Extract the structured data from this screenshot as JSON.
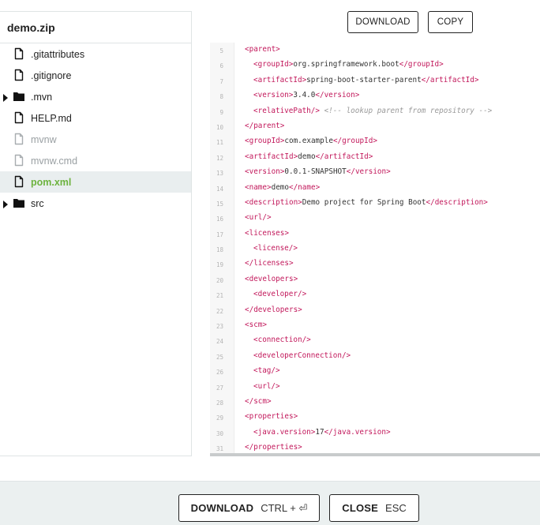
{
  "explorer": {
    "title": "demo.zip",
    "items": [
      {
        "label": ".gitattributes",
        "type": "file",
        "state": "normal"
      },
      {
        "label": ".gitignore",
        "type": "file",
        "state": "normal"
      },
      {
        "label": ".mvn",
        "type": "folder",
        "state": "collapsed"
      },
      {
        "label": "HELP.md",
        "type": "file",
        "state": "normal"
      },
      {
        "label": "mvnw",
        "type": "file",
        "state": "disabled"
      },
      {
        "label": "mvnw.cmd",
        "type": "file",
        "state": "disabled"
      },
      {
        "label": "pom.xml",
        "type": "file",
        "state": "active"
      },
      {
        "label": "src",
        "type": "folder",
        "state": "collapsed"
      }
    ]
  },
  "toolbar": {
    "download_label": "DOWNLOAD",
    "copy_label": "COPY"
  },
  "code": {
    "lines": [
      {
        "n": "5",
        "indent": 0,
        "parts": [
          [
            "tag",
            "<parent>"
          ]
        ]
      },
      {
        "n": "6",
        "indent": 1,
        "parts": [
          [
            "tag",
            "<groupId>"
          ],
          [
            "plain",
            "org.springframework.boot"
          ],
          [
            "tag",
            "</groupId>"
          ]
        ]
      },
      {
        "n": "7",
        "indent": 1,
        "parts": [
          [
            "tag",
            "<artifactId>"
          ],
          [
            "plain",
            "spring-boot-starter-parent"
          ],
          [
            "tag",
            "</artifactId>"
          ]
        ]
      },
      {
        "n": "8",
        "indent": 1,
        "parts": [
          [
            "tag",
            "<version>"
          ],
          [
            "plain",
            "3.4.0"
          ],
          [
            "tag",
            "</version>"
          ]
        ]
      },
      {
        "n": "9",
        "indent": 1,
        "parts": [
          [
            "tag",
            "<relativePath/>"
          ],
          [
            "plain",
            " "
          ],
          [
            "comment",
            "<!-- lookup parent from repository -->"
          ]
        ]
      },
      {
        "n": "10",
        "indent": 0,
        "parts": [
          [
            "tag",
            "</parent>"
          ]
        ]
      },
      {
        "n": "11",
        "indent": 0,
        "parts": [
          [
            "tag",
            "<groupId>"
          ],
          [
            "plain",
            "com.example"
          ],
          [
            "tag",
            "</groupId>"
          ]
        ]
      },
      {
        "n": "12",
        "indent": 0,
        "parts": [
          [
            "tag",
            "<artifactId>"
          ],
          [
            "plain",
            "demo"
          ],
          [
            "tag",
            "</artifactId>"
          ]
        ]
      },
      {
        "n": "13",
        "indent": 0,
        "parts": [
          [
            "tag",
            "<version>"
          ],
          [
            "plain",
            "0.0.1-SNAPSHOT"
          ],
          [
            "tag",
            "</version>"
          ]
        ]
      },
      {
        "n": "14",
        "indent": 0,
        "parts": [
          [
            "tag",
            "<name>"
          ],
          [
            "plain",
            "demo"
          ],
          [
            "tag",
            "</name>"
          ]
        ]
      },
      {
        "n": "15",
        "indent": 0,
        "parts": [
          [
            "tag",
            "<description>"
          ],
          [
            "plain",
            "Demo project for Spring Boot"
          ],
          [
            "tag",
            "</description>"
          ]
        ]
      },
      {
        "n": "16",
        "indent": 0,
        "parts": [
          [
            "tag",
            "<url/>"
          ]
        ]
      },
      {
        "n": "17",
        "indent": 0,
        "parts": [
          [
            "tag",
            "<licenses>"
          ]
        ]
      },
      {
        "n": "18",
        "indent": 1,
        "parts": [
          [
            "tag",
            "<license/>"
          ]
        ]
      },
      {
        "n": "19",
        "indent": 0,
        "parts": [
          [
            "tag",
            "</licenses>"
          ]
        ]
      },
      {
        "n": "20",
        "indent": 0,
        "parts": [
          [
            "tag",
            "<developers>"
          ]
        ]
      },
      {
        "n": "21",
        "indent": 1,
        "parts": [
          [
            "tag",
            "<developer/>"
          ]
        ]
      },
      {
        "n": "22",
        "indent": 0,
        "parts": [
          [
            "tag",
            "</developers>"
          ]
        ]
      },
      {
        "n": "23",
        "indent": 0,
        "parts": [
          [
            "tag",
            "<scm>"
          ]
        ]
      },
      {
        "n": "24",
        "indent": 1,
        "parts": [
          [
            "tag",
            "<connection/>"
          ]
        ]
      },
      {
        "n": "25",
        "indent": 1,
        "parts": [
          [
            "tag",
            "<developerConnection/>"
          ]
        ]
      },
      {
        "n": "26",
        "indent": 1,
        "parts": [
          [
            "tag",
            "<tag/>"
          ]
        ]
      },
      {
        "n": "27",
        "indent": 1,
        "parts": [
          [
            "tag",
            "<url/>"
          ]
        ]
      },
      {
        "n": "28",
        "indent": 0,
        "parts": [
          [
            "tag",
            "</scm>"
          ]
        ]
      },
      {
        "n": "29",
        "indent": 0,
        "parts": [
          [
            "tag",
            "<properties>"
          ]
        ]
      },
      {
        "n": "30",
        "indent": 1,
        "parts": [
          [
            "tag",
            "<java.version>"
          ],
          [
            "plain",
            "17"
          ],
          [
            "tag",
            "</java.version>"
          ]
        ]
      },
      {
        "n": "31",
        "indent": 0,
        "parts": [
          [
            "tag",
            "</properties>"
          ]
        ]
      }
    ]
  },
  "action_bar": {
    "download_label": "DOWNLOAD",
    "download_shortcut": "CTRL + ⏎",
    "close_label": "CLOSE",
    "close_shortcut": "ESC"
  },
  "colors": {
    "accent_green": "#6db33f",
    "tag_color": "#c2185b",
    "bar_background": "#ebf0f0"
  }
}
